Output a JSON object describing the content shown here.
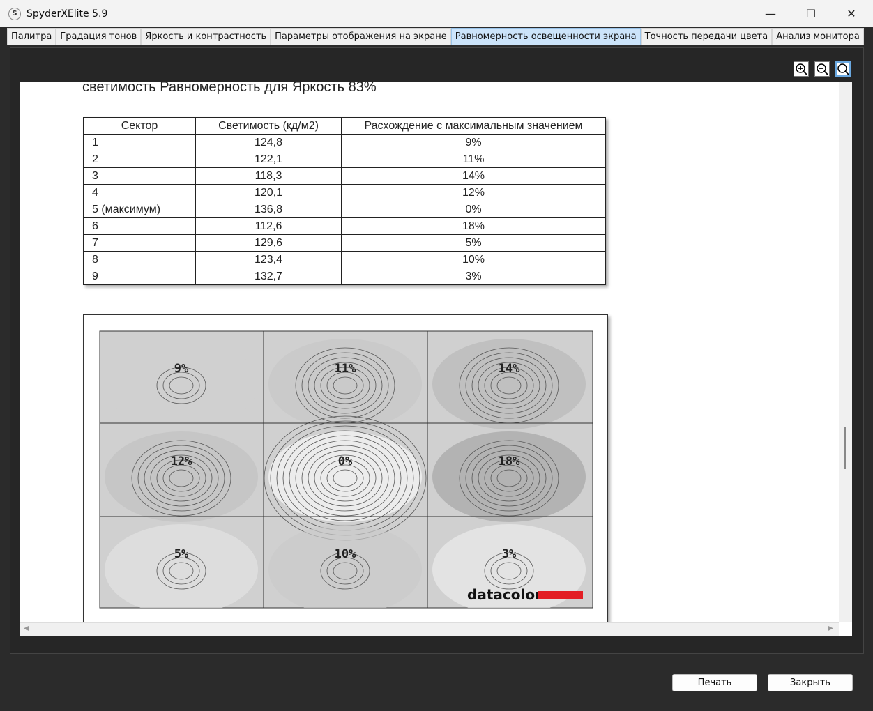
{
  "window": {
    "title": "SpyderXElite 5.9",
    "logo_letter": "S"
  },
  "tabs": [
    {
      "label": "Палитра",
      "active": false
    },
    {
      "label": "Градация тонов",
      "active": false
    },
    {
      "label": "Яркость и контрастность",
      "active": false
    },
    {
      "label": "Параметры отображения на экране",
      "active": false
    },
    {
      "label": "Равномерность освещенности экрана",
      "active": true
    },
    {
      "label": "Точность передачи цвета",
      "active": false
    },
    {
      "label": "Анализ монитора",
      "active": false
    }
  ],
  "report": {
    "title": "светимость Равномерность для Яркость 83%",
    "table": {
      "headers": [
        "Сектор",
        "Светимость (кд/м2)",
        "Расхождение с максимальным значением"
      ],
      "rows": [
        [
          "1",
          "124,8",
          "9%"
        ],
        [
          "2",
          "122,1",
          "11%"
        ],
        [
          "3",
          "118,3",
          "14%"
        ],
        [
          "4",
          "120,1",
          "12%"
        ],
        [
          "5 (максимум)",
          "136,8",
          "0%"
        ],
        [
          "6",
          "112,6",
          "18%"
        ],
        [
          "7",
          "129,6",
          "5%"
        ],
        [
          "8",
          "123,4",
          "10%"
        ],
        [
          "9",
          "132,7",
          "3%"
        ]
      ]
    },
    "contour_labels": [
      "9%",
      "11%",
      "14%",
      "12%",
      "0%",
      "18%",
      "5%",
      "10%",
      "3%"
    ],
    "brand": "datacolor",
    "brand_color": "#e31e24"
  },
  "buttons": {
    "print": "Печать",
    "close": "Закрыть"
  }
}
